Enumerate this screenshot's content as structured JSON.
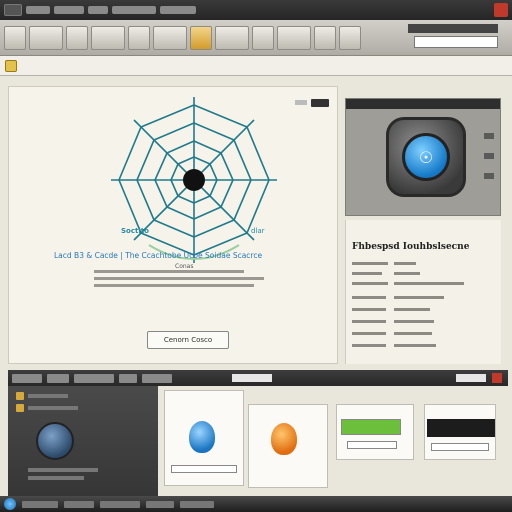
{
  "window": {
    "title": ""
  },
  "main": {
    "web_label_left": "Soctito",
    "web_label_right": "dlar",
    "web_label_bottom": "Conas",
    "caption": "Lacd B3 & Cacde | The Ccachtobe Ucbe Soidae Scacrce",
    "button_label": "Cenorn Cosco"
  },
  "info": {
    "title": "Fhbespsd Iouhbslsecne"
  },
  "colors": {
    "accent": "#2a78b8",
    "web_stroke": "#1f7a8c",
    "alert": "#c0392b"
  },
  "icons": [
    "shield-icon",
    "spider-web-icon",
    "device-icon",
    "start-icon"
  ]
}
